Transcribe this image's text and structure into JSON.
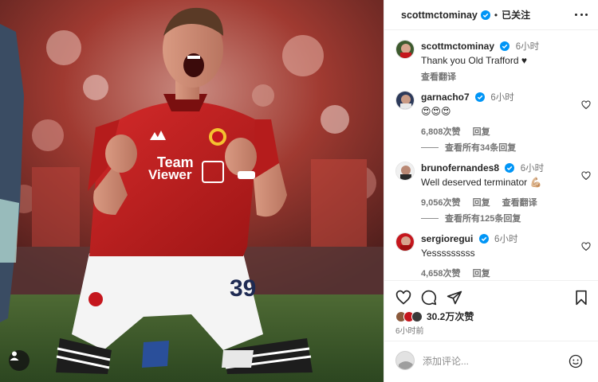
{
  "post": {
    "author": "scottmctominay",
    "follow_state": "已关注",
    "separator": "•",
    "shirt_sponsor_top": "Team",
    "shirt_sponsor_bottom": "Viewer",
    "shirt_number": "39",
    "icons": {
      "tagged_people": "person-tag-icon",
      "verified": "verified-badge-icon",
      "more": "more-options-icon"
    }
  },
  "caption": {
    "user": "scottmctominay",
    "time": "6小时",
    "text": "Thank you Old Trafford",
    "heart": "♥",
    "translate": "查看翻译"
  },
  "comments": [
    {
      "user": "garnacho7",
      "time": "6小时",
      "text": "😍😍😍",
      "likes": "6,808次赞",
      "reply": "回复",
      "translate": "",
      "view_replies": "查看所有34条回复"
    },
    {
      "user": "brunofernandes8",
      "time": "6小时",
      "text": "Well deserved terminator 💪🏼",
      "likes": "9,056次赞",
      "reply": "回复",
      "translate": "查看翻译",
      "view_replies": "查看所有125条回复"
    },
    {
      "user": "sergioregui",
      "time": "6小时",
      "text": "Yesssssssss",
      "likes": "4,658次赞",
      "reply": "回复",
      "translate": "",
      "view_replies": ""
    }
  ],
  "actions": {
    "like": "heart-icon",
    "comment": "comment-icon",
    "share": "send-icon",
    "save": "bookmark-icon"
  },
  "likes": {
    "count": "30.2万次赞",
    "time": "6小时前"
  },
  "composer": {
    "placeholder": "添加评论...",
    "emoji": "emoji-icon"
  },
  "colors": {
    "verified_blue": "#0095f6",
    "united_red": "#c5161d",
    "text": "#262626",
    "secondary_text": "#737373"
  }
}
